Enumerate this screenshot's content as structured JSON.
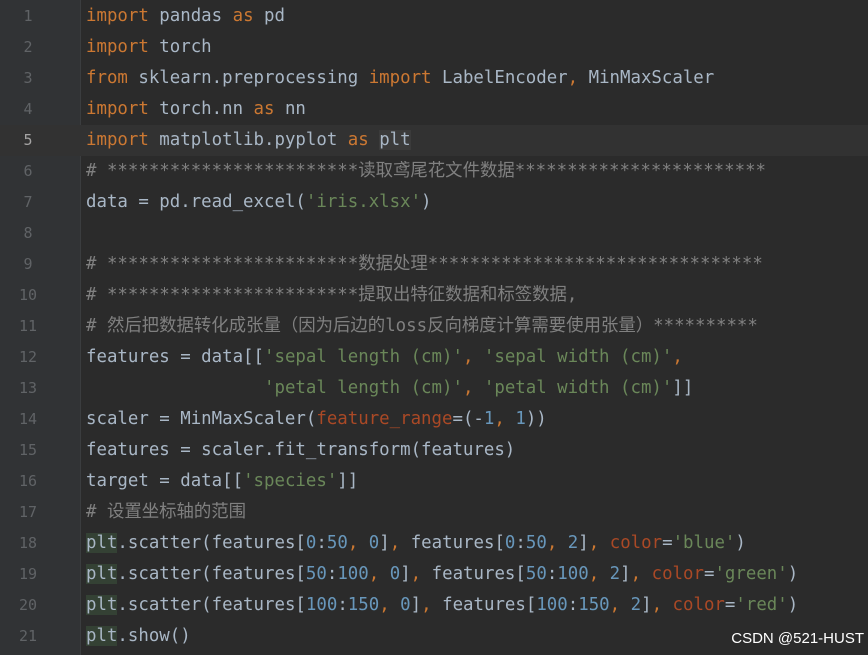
{
  "editor": {
    "current_line": 5,
    "lines": [
      {
        "n": "1",
        "tokens": [
          [
            "kw",
            "import"
          ],
          [
            "id",
            " pandas "
          ],
          [
            "kw",
            "as"
          ],
          [
            "id",
            " pd"
          ]
        ]
      },
      {
        "n": "2",
        "tokens": [
          [
            "kw",
            "import"
          ],
          [
            "id",
            " torch"
          ]
        ]
      },
      {
        "n": "3",
        "tokens": [
          [
            "kw",
            "from"
          ],
          [
            "id",
            " sklearn.preprocessing "
          ],
          [
            "kw",
            "import"
          ],
          [
            "id",
            " LabelEncoder"
          ],
          [
            "pu",
            ","
          ],
          [
            "id",
            " MinMaxScaler"
          ]
        ]
      },
      {
        "n": "4",
        "tokens": [
          [
            "kw",
            "import"
          ],
          [
            "id",
            " torch.nn "
          ],
          [
            "kw",
            "as"
          ],
          [
            "id",
            " nn"
          ]
        ]
      },
      {
        "n": "5",
        "tokens": [
          [
            "kw",
            "import"
          ],
          [
            "id",
            " matplotlib.pyplot "
          ],
          [
            "kw",
            "as"
          ],
          [
            "id",
            " "
          ],
          [
            "hl2",
            "plt"
          ]
        ]
      },
      {
        "n": "6",
        "tokens": [
          [
            "cm",
            "# ************************读取鸢尾花文件数据************************"
          ]
        ]
      },
      {
        "n": "7",
        "tokens": [
          [
            "id",
            "data = pd.read_excel("
          ],
          [
            "st",
            "'iris.xlsx'"
          ],
          [
            "id",
            ")"
          ]
        ]
      },
      {
        "n": "8",
        "tokens": []
      },
      {
        "n": "9",
        "tokens": [
          [
            "cm",
            "# ************************数据处理********************************"
          ]
        ]
      },
      {
        "n": "10",
        "tokens": [
          [
            "cm",
            "# ************************提取出特征数据和标签数据,"
          ]
        ]
      },
      {
        "n": "11",
        "tokens": [
          [
            "cm",
            "# 然后把数据转化成张量（因为后边的loss反向梯度计算需要使用张量）**********"
          ]
        ]
      },
      {
        "n": "12",
        "tokens": [
          [
            "id",
            "features = data[["
          ],
          [
            "st",
            "'sepal length (cm)'"
          ],
          [
            "pu",
            ", "
          ],
          [
            "st",
            "'sepal width (cm)'"
          ],
          [
            "pu",
            ","
          ]
        ]
      },
      {
        "n": "13",
        "tokens": [
          [
            "id",
            "                 "
          ],
          [
            "st",
            "'petal length (cm)'"
          ],
          [
            "pu",
            ", "
          ],
          [
            "st",
            "'petal width (cm)'"
          ],
          [
            "id",
            "]]"
          ]
        ]
      },
      {
        "n": "14",
        "tokens": [
          [
            "id",
            "scaler = MinMaxScaler("
          ],
          [
            "pa",
            "feature_range"
          ],
          [
            "id",
            "=(-"
          ],
          [
            "nu",
            "1"
          ],
          [
            "pu",
            ", "
          ],
          [
            "nu",
            "1"
          ],
          [
            "id",
            "))"
          ]
        ]
      },
      {
        "n": "15",
        "tokens": [
          [
            "id",
            "features = scaler.fit_transform(features)"
          ]
        ]
      },
      {
        "n": "16",
        "tokens": [
          [
            "id",
            "target = data[["
          ],
          [
            "st",
            "'species'"
          ],
          [
            "id",
            "]]"
          ]
        ]
      },
      {
        "n": "17",
        "tokens": [
          [
            "cm",
            "# 设置坐标轴的范围"
          ]
        ]
      },
      {
        "n": "18",
        "tokens": [
          [
            "hl",
            "plt"
          ],
          [
            "id",
            ".scatter(features["
          ],
          [
            "nu",
            "0"
          ],
          [
            "id",
            ":"
          ],
          [
            "nu",
            "50"
          ],
          [
            "pu",
            ", "
          ],
          [
            "nu",
            "0"
          ],
          [
            "id",
            "]"
          ],
          [
            "pu",
            ", "
          ],
          [
            "id",
            "features["
          ],
          [
            "nu",
            "0"
          ],
          [
            "id",
            ":"
          ],
          [
            "nu",
            "50"
          ],
          [
            "pu",
            ", "
          ],
          [
            "nu",
            "2"
          ],
          [
            "id",
            "]"
          ],
          [
            "pu",
            ", "
          ],
          [
            "pa",
            "color"
          ],
          [
            "id",
            "="
          ],
          [
            "st",
            "'blue'"
          ],
          [
            "id",
            ")"
          ]
        ]
      },
      {
        "n": "19",
        "tokens": [
          [
            "hl",
            "plt"
          ],
          [
            "id",
            ".scatter(features["
          ],
          [
            "nu",
            "50"
          ],
          [
            "id",
            ":"
          ],
          [
            "nu",
            "100"
          ],
          [
            "pu",
            ", "
          ],
          [
            "nu",
            "0"
          ],
          [
            "id",
            "]"
          ],
          [
            "pu",
            ", "
          ],
          [
            "id",
            "features["
          ],
          [
            "nu",
            "50"
          ],
          [
            "id",
            ":"
          ],
          [
            "nu",
            "100"
          ],
          [
            "pu",
            ", "
          ],
          [
            "nu",
            "2"
          ],
          [
            "id",
            "]"
          ],
          [
            "pu",
            ", "
          ],
          [
            "pa",
            "color"
          ],
          [
            "id",
            "="
          ],
          [
            "st",
            "'green'"
          ],
          [
            "id",
            ")"
          ]
        ]
      },
      {
        "n": "20",
        "tokens": [
          [
            "hl",
            "plt"
          ],
          [
            "id",
            ".scatter(features["
          ],
          [
            "nu",
            "100"
          ],
          [
            "id",
            ":"
          ],
          [
            "nu",
            "150"
          ],
          [
            "pu",
            ", "
          ],
          [
            "nu",
            "0"
          ],
          [
            "id",
            "]"
          ],
          [
            "pu",
            ", "
          ],
          [
            "id",
            "features["
          ],
          [
            "nu",
            "100"
          ],
          [
            "id",
            ":"
          ],
          [
            "nu",
            "150"
          ],
          [
            "pu",
            ", "
          ],
          [
            "nu",
            "2"
          ],
          [
            "id",
            "]"
          ],
          [
            "pu",
            ", "
          ],
          [
            "pa",
            "color"
          ],
          [
            "id",
            "="
          ],
          [
            "st",
            "'red'"
          ],
          [
            "id",
            ")"
          ]
        ]
      },
      {
        "n": "21",
        "tokens": [
          [
            "hl",
            "plt"
          ],
          [
            "id",
            ".show()"
          ]
        ]
      }
    ]
  },
  "watermark": "CSDN @521-HUST"
}
